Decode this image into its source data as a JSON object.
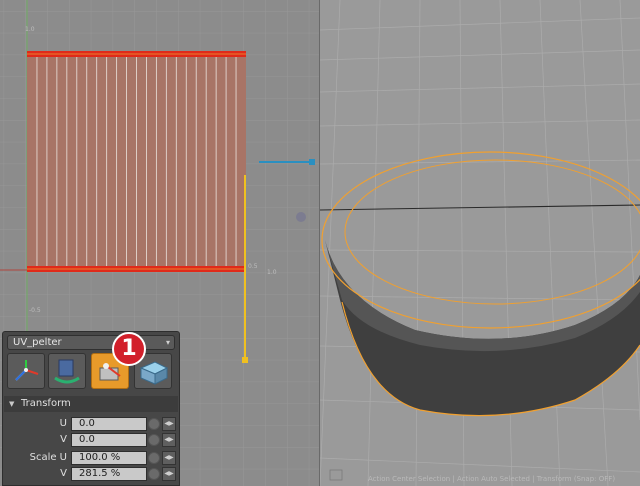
{
  "tool_preset": {
    "selected": "UV_pelter",
    "arrow_glyph": "▾"
  },
  "tool_icons": [
    {
      "name": "transform-tool-icon"
    },
    {
      "name": "rotate-tool-icon"
    },
    {
      "name": "pelt-tool-icon",
      "active": true
    },
    {
      "name": "relax-tool-icon"
    }
  ],
  "callout_badge": "1",
  "transform_section": {
    "title": "Transform",
    "collapse_glyph": "▼",
    "rows": [
      {
        "label": "U",
        "value": "0.0"
      },
      {
        "label": "V",
        "value": "0.0"
      },
      {
        "label": "Scale U",
        "value": "100.0 %"
      },
      {
        "label": "V",
        "value": "281.5 %"
      }
    ]
  },
  "uv_viewport": {
    "tick_labels": [
      "0",
      "1.0",
      "0.5",
      "-0.5",
      "1.0"
    ],
    "island_color": "#a87466",
    "edge_highlight_color": "#e02a1a"
  },
  "status_bar": {
    "text": "Action Center Selection | Action Auto Selected | Transform (Snap: OFF)"
  },
  "colors": {
    "accent_orange": "#e89a2a",
    "handle_yellow": "#f0c020",
    "handle_blue": "#2a8fc0",
    "selection_orange": "#f0a030"
  }
}
